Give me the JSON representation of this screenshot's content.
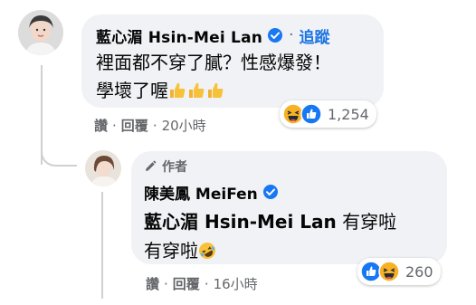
{
  "comment": {
    "author": "藍心湄 Hsin-Mei Lan",
    "separator": "·",
    "follow_label": "追蹤",
    "text_line1": "裡面都不穿了膩？性感爆發！",
    "text_line2": "學壞了喔",
    "actions": {
      "like": "讚",
      "dot": "·",
      "reply": "回覆",
      "time": "20小時"
    },
    "reactions": {
      "count": "1,254",
      "types": [
        "haha-icon",
        "like-icon"
      ]
    }
  },
  "reply": {
    "badge": "作者",
    "author": "陳美鳳 MeiFen",
    "mention": "藍心湄 Hsin-Mei Lan",
    "text_after_mention": " 有穿啦",
    "text_line2": "有穿啦",
    "actions": {
      "like": "讚",
      "dot": "·",
      "reply": "回覆",
      "time": "16小時"
    },
    "reactions": {
      "count": "260",
      "types": [
        "like-icon",
        "haha-icon"
      ]
    }
  },
  "colors": {
    "bubble": "#f0f2f5",
    "link": "#1b74e4",
    "secondary_text": "#65676b",
    "like_blue": "#1877f2",
    "haha_yellow": "#f7b125"
  }
}
